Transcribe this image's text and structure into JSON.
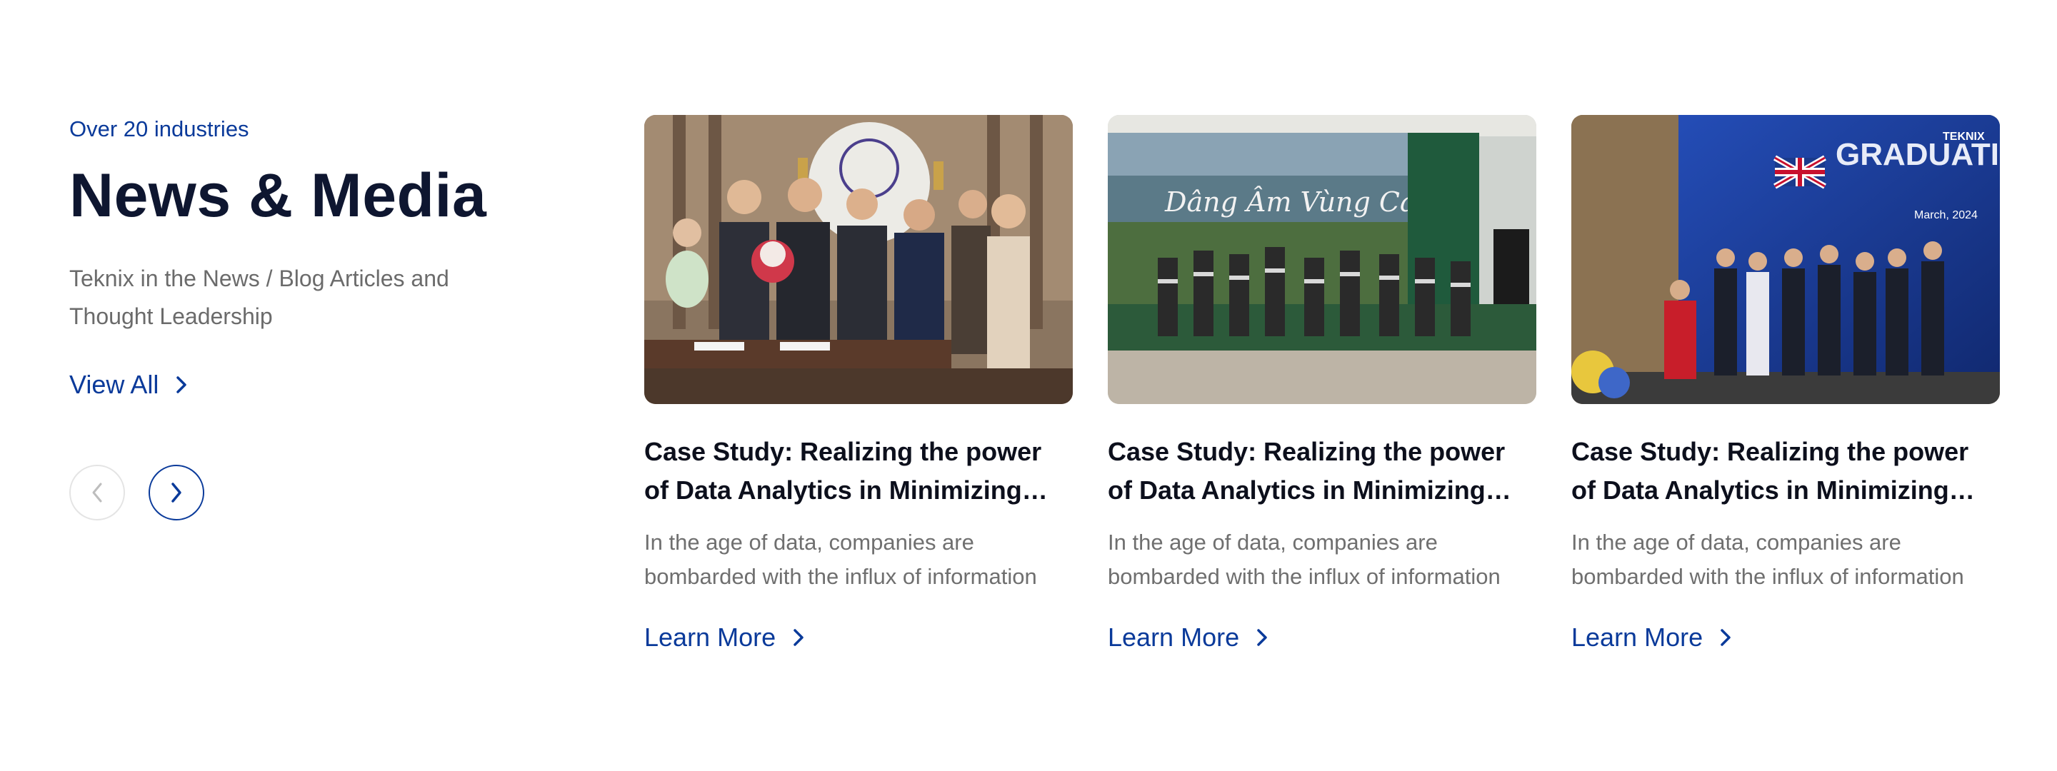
{
  "section": {
    "eyebrow": "Over 20 industries",
    "title": "News & Media",
    "description": "Teknix in the News / Blog Articles and Thought Leadership",
    "view_all_label": "View All"
  },
  "colors": {
    "accent": "#0a3a9a",
    "heading": "#0e1630",
    "muted": "#6b6b6b"
  },
  "cards": [
    {
      "image_text": "",
      "title": "Case Study: Realizing the power of Data Analytics in Minimizing Transaction Costs",
      "excerpt": "In the age of data, companies are bombarded with the influx of information",
      "cta": "Learn More"
    },
    {
      "image_text": "Dâng Âm Vùng Cao",
      "title": "Case Study: Realizing the power of Data Analytics in Minimizing Transaction Costs",
      "excerpt": "In the age of data, companies are bombarded with the influx of information",
      "cta": "Learn More"
    },
    {
      "image_text": "GRADUATION CEREMONY",
      "image_badge": "TEKNIX",
      "image_date": "March, 2024",
      "title": "Case Study: Realizing the power of Data Analytics in Minimizing Transaction Costs",
      "excerpt": "In the age of data, companies are bombarded with the influx of information",
      "cta": "Learn More"
    }
  ],
  "icons": {
    "view_all": "chevron-right-icon",
    "prev": "chevron-left-icon",
    "next": "chevron-right-icon",
    "learn_more": "chevron-right-icon"
  }
}
